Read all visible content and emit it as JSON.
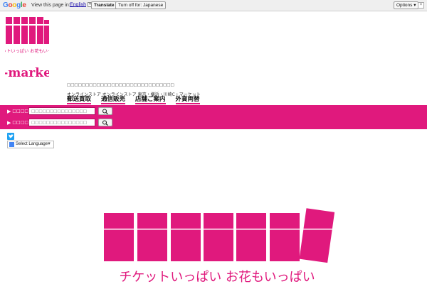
{
  "translate_bar": {
    "logo": "Google",
    "view_text": "View this page in:",
    "language": "English",
    "dropdown_glyph": "▾",
    "translate_label": "Translate",
    "turn_off_label": "Turn off for: Japanese",
    "options_label": "Options ▾",
    "close_glyph": "×"
  },
  "logo": {
    "slogan": "チケットいっぱい お花もいっぱい",
    "brand": "J-market"
  },
  "tagline": "□□□□□□□□□□□□□□□□□□□□□□□□□□□□□",
  "subtext": "オンラインストア オンラインストア 東京・横浜・川崎C・マーケット",
  "nav": {
    "items": [
      "郵送買取",
      "通信販売",
      "店舗ご案内",
      "外貨両替"
    ]
  },
  "search": {
    "rows": [
      {
        "label": "□□□□",
        "placeholder": "□□□□□□□□□□□□□□□"
      },
      {
        "label": "□□□□",
        "placeholder": "□□□□□□□□□□□□□□□"
      }
    ]
  },
  "language_select": {
    "label": "Select Language",
    "arrow": "▼"
  },
  "hero": {
    "slogan": "チケットいっぱい お花もいっぱい"
  },
  "colors": {
    "brand_pink": "#e0197d",
    "twitter_blue": "#1da1f2"
  },
  "icons": [
    "search-icon",
    "twitter-icon",
    "google-translate-icon",
    "ticket-icon"
  ]
}
